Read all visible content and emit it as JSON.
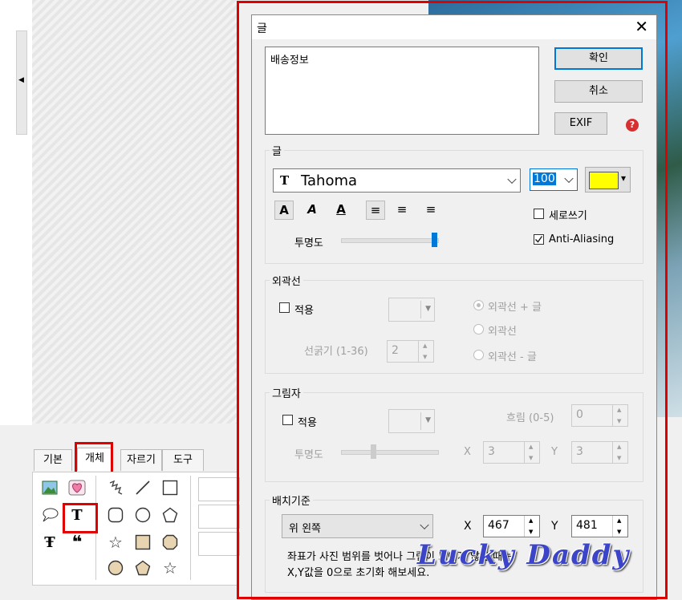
{
  "tool_tabs": [
    "기본",
    "개체",
    "자르기",
    "도구"
  ],
  "dialog": {
    "title": "글",
    "close_glyph": "✕",
    "text_value": "배송정보",
    "buttons": {
      "ok": "확인",
      "cancel": "취소",
      "exif": "EXIF",
      "help_glyph": "?"
    },
    "text_group": {
      "label": "글",
      "font_icon_glyph": "T",
      "font": "Tahoma",
      "size": "100",
      "color": "#ffff00",
      "color_arrow": "▾",
      "opacity_label": "투명도",
      "opacity_level": 1.0,
      "vertical_label": "세로쓰기",
      "vertical_checked": false,
      "antialias_label": "Anti-Aliasing",
      "antialias_checked": true,
      "format_glyphs": [
        "A",
        "A",
        "A"
      ],
      "align_glyphs": [
        "≡",
        "≡",
        "≡"
      ]
    },
    "outline_group": {
      "label": "외곽선",
      "apply_label": "적용",
      "width_label": "선굵기 (1-36)",
      "width_value": "2",
      "options": [
        "외곽선 + 글",
        "외곽선",
        "외곽선 - 글"
      ]
    },
    "shadow_group": {
      "label": "그림자",
      "apply_label": "적용",
      "blur_label": "흐림 (0-5)",
      "blur_value": "0",
      "opacity_label": "투명도",
      "x_label": "X",
      "x_value": "3",
      "y_label": "Y",
      "y_value": "3"
    },
    "position_group": {
      "label": "배치기준",
      "anchor": "위 왼쪽",
      "x_label": "X",
      "x_value": "467",
      "y_label": "Y",
      "y_value": "481",
      "note_line1": "좌표가 사진 범위를 벗어나 그림이 보이지 않을 때는",
      "note_line2": "X,Y값을 0으로 초기화 해보세요."
    }
  },
  "watermark": "Lucky Daddy",
  "colors": {
    "highlight": "#e00000",
    "accent": "#0078d7"
  }
}
